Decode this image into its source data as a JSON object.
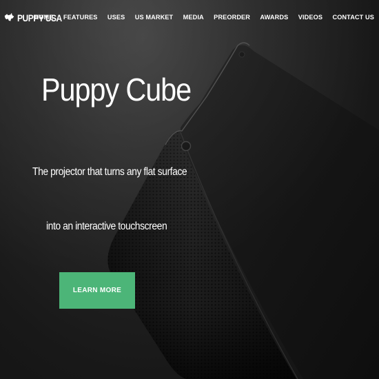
{
  "brand": {
    "name": "PUPPY USA",
    "logo_icon": "puppy-silhouette-icon"
  },
  "nav": {
    "items": [
      "HOME",
      "FEATURES",
      "USES",
      "US MARKET",
      "MEDIA",
      "PREORDER",
      "AWARDS",
      "VIDEOS",
      "CONTACT US"
    ]
  },
  "hero": {
    "title": "Puppy Cube",
    "subtitle_line1": "The projector that turns any flat surface",
    "subtitle_line2": "into an interactive touchscreen",
    "cta_label": "LEARN MORE"
  },
  "colors": {
    "background": "#1a1a1a",
    "cta": "#4cb578",
    "text": "#ffffff"
  }
}
